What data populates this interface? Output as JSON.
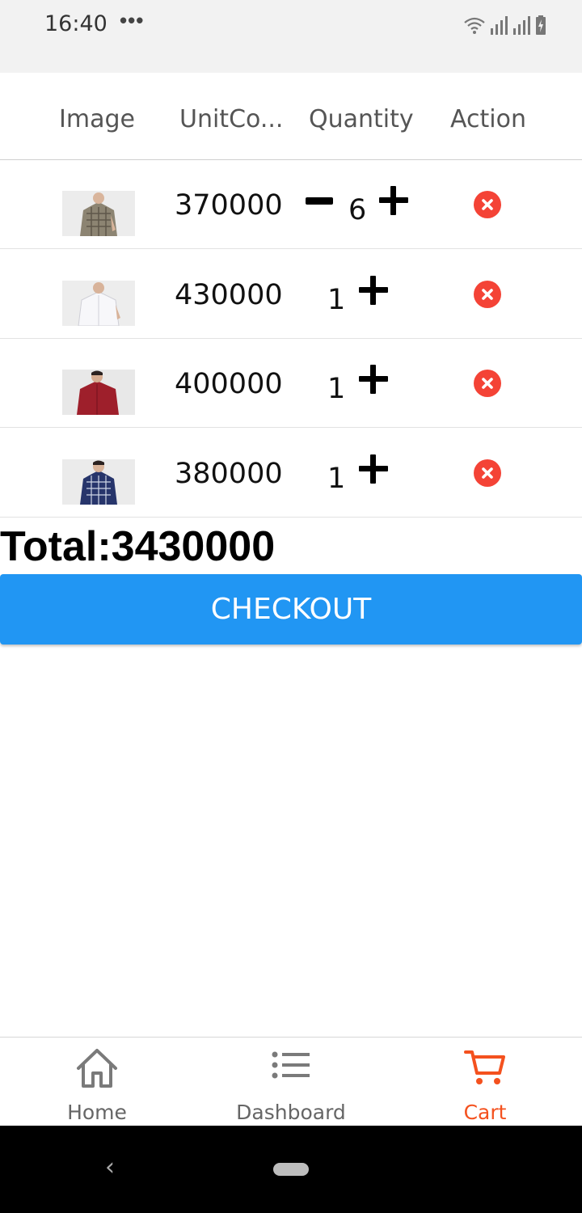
{
  "status_bar": {
    "time": "16:40",
    "dots": "•••"
  },
  "table": {
    "headers": [
      "Image",
      "UnitCo...",
      "Quantity",
      "Action"
    ],
    "rows": [
      {
        "unit_cost": "370000",
        "quantity": "6",
        "shirt": "beige plaid short-sleeve shirt",
        "color": "#8c8472",
        "show_minus": true
      },
      {
        "unit_cost": "430000",
        "quantity": "1",
        "shirt": "white short-sleeve shirt",
        "color": "#f3f3f6",
        "show_minus": false
      },
      {
        "unit_cost": "400000",
        "quantity": "1",
        "shirt": "burgundy short-sleeve shirt",
        "color": "#9e1f2b",
        "show_minus": false
      },
      {
        "unit_cost": "380000",
        "quantity": "1",
        "shirt": "navy plaid short-sleeve shirt",
        "color": "#27356b",
        "show_minus": false
      }
    ]
  },
  "total_text": "Total:3430000",
  "checkout_label": "CHECKOUT",
  "nav": {
    "items": [
      {
        "label": "Home",
        "icon": "home-icon",
        "active": false
      },
      {
        "label": "Dashboard",
        "icon": "list-icon",
        "active": false
      },
      {
        "label": "Cart",
        "icon": "cart-icon",
        "active": true
      }
    ]
  },
  "colors": {
    "accent_blue": "#2196f3",
    "active_nav": "#f4511e",
    "remove_red": "#f44336"
  },
  "system_nav": {
    "back": "‹"
  }
}
